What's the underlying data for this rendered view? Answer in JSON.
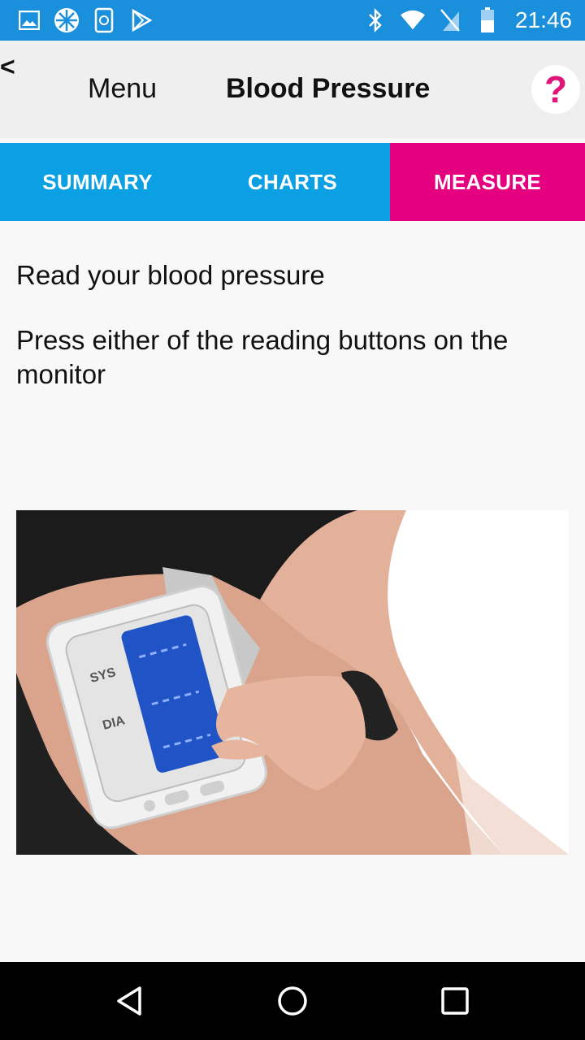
{
  "status_bar": {
    "time": "21:46",
    "left_icons": [
      "gallery-icon",
      "pinwheel-icon",
      "sync-phone-icon",
      "play-store-icon"
    ],
    "right_icons": [
      "bluetooth-icon",
      "wifi-icon",
      "no-sim-icon",
      "battery-icon"
    ]
  },
  "header": {
    "back_label": "<",
    "menu_label": "Menu",
    "title": "Blood Pressure",
    "help_label": "?"
  },
  "tabs": [
    {
      "label": "SUMMARY",
      "active": false
    },
    {
      "label": "CHARTS",
      "active": false
    },
    {
      "label": "MEASURE",
      "active": true
    }
  ],
  "main": {
    "heading": "Read your blood pressure",
    "instruction": "Press either of the reading buttons on the monitor",
    "image": {
      "description": "blood-pressure-monitor-on-arm",
      "monitor_labels": [
        "SYS",
        "DIA"
      ]
    }
  },
  "colors": {
    "status_bar": "#1a8fdc",
    "tab_bar": "#0aa0e3",
    "active_tab": "#e5007f",
    "help_icon": "#e0157a"
  },
  "nav_bar": {
    "icons": [
      "back-triangle-icon",
      "home-circle-icon",
      "recents-square-icon"
    ]
  }
}
